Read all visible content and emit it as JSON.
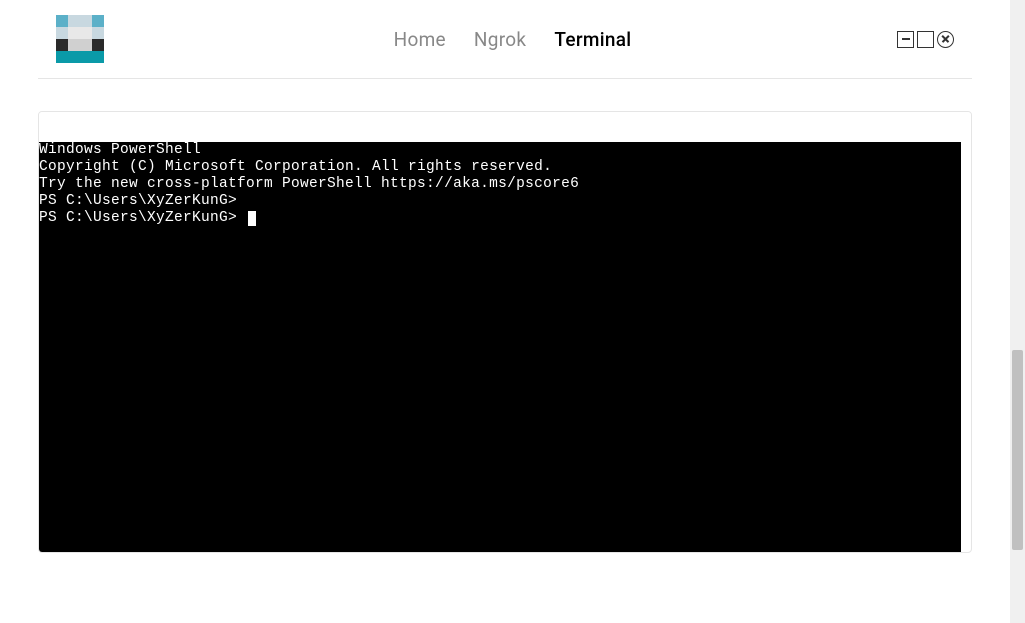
{
  "nav": {
    "items": [
      {
        "label": "Home",
        "active": false
      },
      {
        "label": "Ngrok",
        "active": false
      },
      {
        "label": "Terminal",
        "active": true
      }
    ]
  },
  "logo": {
    "pixels": [
      "#5bb0c8",
      "#c8d8e0",
      "#c8d8e0",
      "#5bb0c8",
      "#c8d8e0",
      "#e8e8e8",
      "#e8e8e8",
      "#c8d8e0",
      "#2a2a2a",
      "#d0d0d0",
      "#d0d0d0",
      "#2a2a2a",
      "#0a9aa8",
      "#0a9aa8",
      "#0a9aa8",
      "#0a9aa8"
    ]
  },
  "window_controls": {
    "minimize": "minimize-icon",
    "maximize": "maximize-icon",
    "close": "close-icon"
  },
  "terminal": {
    "lines": [
      "Windows PowerShell",
      "Copyright (C) Microsoft Corporation. All rights reserved.",
      "",
      "Try the new cross-platform PowerShell https://aka.ms/pscore6",
      "",
      "PS C:\\Users\\XyZerKunG>",
      "PS C:\\Users\\XyZerKunG> "
    ],
    "cursor_on_last": true
  }
}
